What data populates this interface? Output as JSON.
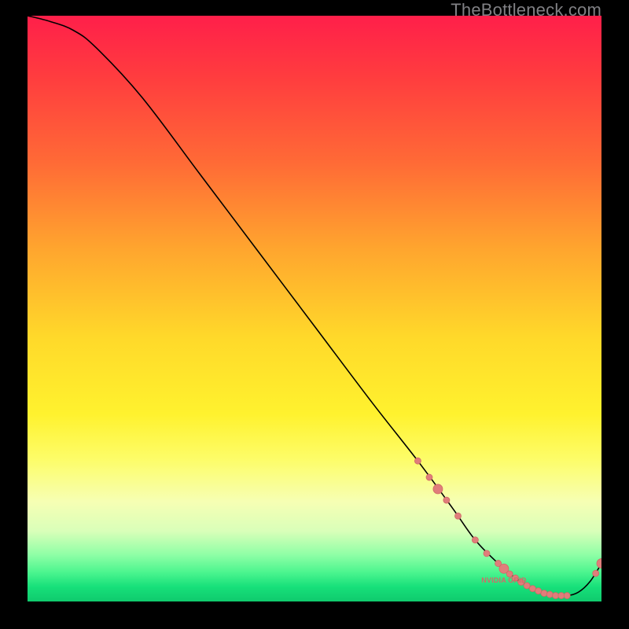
{
  "watermark": "TheBottleneck.com",
  "chart_data": {
    "type": "line",
    "title": "",
    "xlabel": "",
    "ylabel": "",
    "xlim": [
      0,
      100
    ],
    "ylim": [
      0,
      100
    ],
    "series": [
      {
        "name": "bottleneck-curve",
        "x": [
          0,
          4,
          8,
          12,
          20,
          30,
          40,
          50,
          60,
          68,
          74,
          78,
          82,
          85,
          88,
          90,
          92,
          94,
          96,
          98,
          100
        ],
        "y": [
          100,
          99,
          97.5,
          94.5,
          86,
          73,
          60,
          47,
          34,
          24,
          16,
          10.5,
          6.5,
          4,
          2.2,
          1.4,
          1.0,
          1.0,
          1.6,
          3.4,
          6.5
        ]
      }
    ],
    "markers": {
      "name": "highlight-points",
      "color": "#e07d7b",
      "radius_small": 4,
      "radius_large": 6,
      "points": [
        {
          "x": 68,
          "y": 24,
          "r": 4
        },
        {
          "x": 70,
          "y": 21.2,
          "r": 4
        },
        {
          "x": 71.5,
          "y": 19.2,
          "r": 6
        },
        {
          "x": 73,
          "y": 17.3,
          "r": 4
        },
        {
          "x": 75,
          "y": 14.6,
          "r": 4
        },
        {
          "x": 78,
          "y": 10.5,
          "r": 4
        },
        {
          "x": 80,
          "y": 8.2,
          "r": 4
        },
        {
          "x": 82,
          "y": 6.5,
          "r": 4
        },
        {
          "x": 83,
          "y": 5.6,
          "r": 6
        },
        {
          "x": 84,
          "y": 4.7,
          "r": 4
        },
        {
          "x": 85,
          "y": 4.0,
          "r": 4
        },
        {
          "x": 86,
          "y": 3.3,
          "r": 4
        },
        {
          "x": 87,
          "y": 2.7,
          "r": 4
        },
        {
          "x": 88,
          "y": 2.2,
          "r": 4
        },
        {
          "x": 89,
          "y": 1.8,
          "r": 4
        },
        {
          "x": 90,
          "y": 1.4,
          "r": 4
        },
        {
          "x": 91,
          "y": 1.2,
          "r": 4
        },
        {
          "x": 92,
          "y": 1.0,
          "r": 4
        },
        {
          "x": 93,
          "y": 1.0,
          "r": 4
        },
        {
          "x": 94,
          "y": 1.0,
          "r": 4
        },
        {
          "x": 100,
          "y": 6.5,
          "r": 6
        },
        {
          "x": 99,
          "y": 4.8,
          "r": 4
        }
      ]
    },
    "annotations": [
      {
        "text": "NVIDIA GRID",
        "x": 83,
        "y": 3.2
      }
    ]
  }
}
